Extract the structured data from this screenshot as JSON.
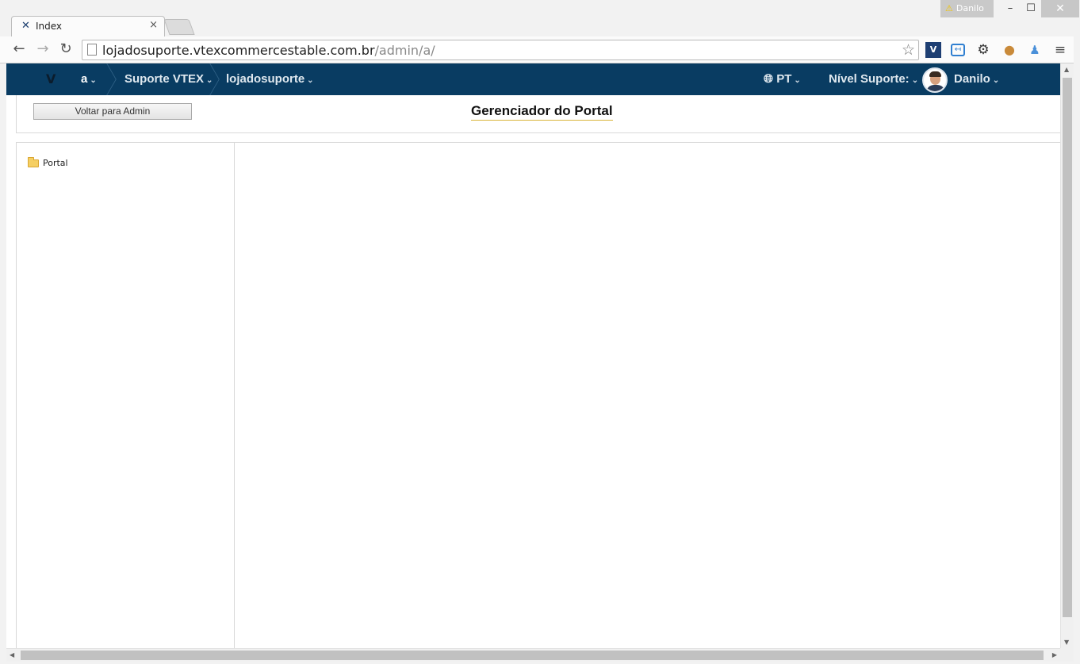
{
  "browser": {
    "tab_title": "Index",
    "tab_close": "×",
    "profile_name": "Danilo",
    "url_host": "lojadosuporte.vtexcommercestable.com.br",
    "url_path": "/admin/a/"
  },
  "window_controls": {
    "minimize": "–",
    "maximize": "☐",
    "close": "✕"
  },
  "appbar": {
    "logo": "V",
    "breadcrumbs": [
      {
        "label": "a"
      },
      {
        "label": "Suporte VTEX"
      },
      {
        "label": "lojadosuporte"
      }
    ],
    "language": "PT",
    "support_level": "Nível Suporte:",
    "user_name": "Danilo"
  },
  "page": {
    "back_button": "Voltar para Admin",
    "title": "Gerenciador do Portal",
    "tree": [
      {
        "label": "Portal"
      }
    ]
  },
  "colors": {
    "appbar_bg": "#093c62",
    "title_underline": "#d9b43b"
  }
}
